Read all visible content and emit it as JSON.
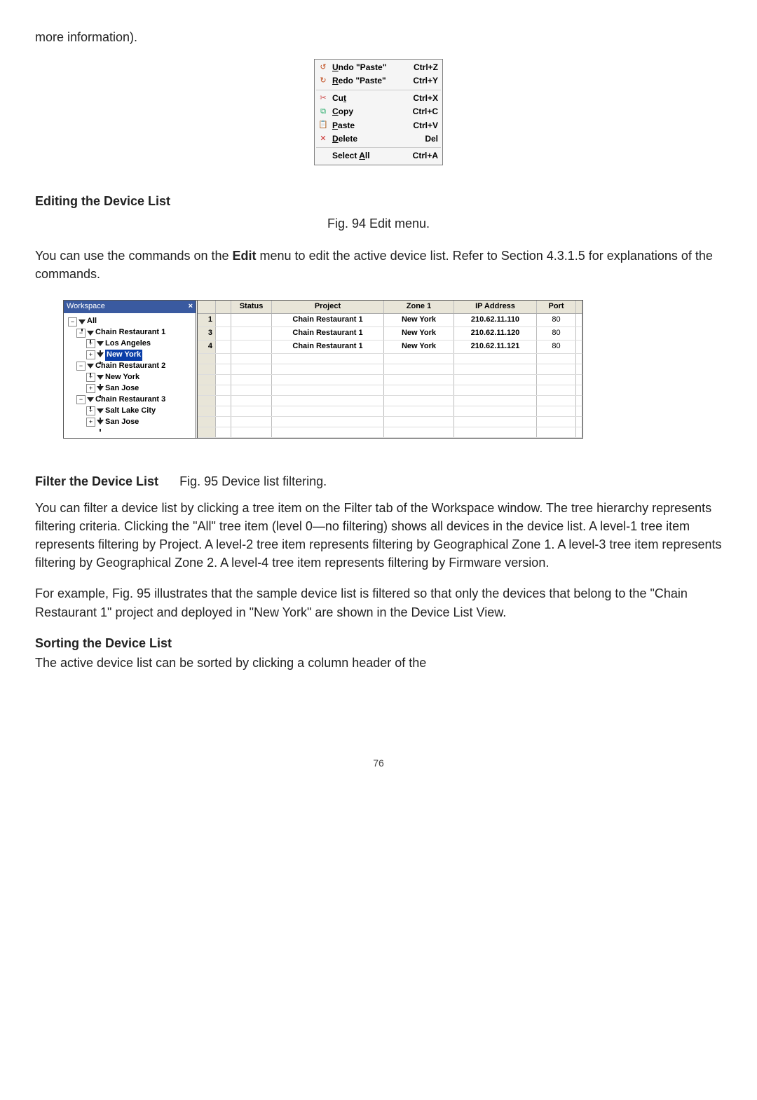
{
  "intro": "more information).",
  "edit_menu": {
    "items": [
      {
        "icon": "undo-icon",
        "glyph": "↺",
        "color": "#c04a1a",
        "label": "Undo \"Paste\"",
        "mn": "U",
        "rest": "ndo \"Paste\"",
        "shortcut": "Ctrl+Z"
      },
      {
        "icon": "redo-icon",
        "glyph": "↻",
        "color": "#c04a1a",
        "label": "Redo \"Paste\"",
        "mn": "R",
        "rest": "edo \"Paste\"",
        "shortcut": "Ctrl+Y"
      },
      {
        "sep": true
      },
      {
        "icon": "cut-icon",
        "glyph": "✂",
        "color": "#c44",
        "label": "Cut",
        "mn": "",
        "pre": "Cu",
        "mn2": "t",
        "shortcut": "Ctrl+X"
      },
      {
        "icon": "copy-icon",
        "glyph": "⧉",
        "color": "#2a6",
        "label": "Copy",
        "mn": "C",
        "rest": "opy",
        "shortcut": "Ctrl+C"
      },
      {
        "icon": "paste-icon",
        "glyph": "📋",
        "color": "#2a6",
        "label": "Paste",
        "mn": "P",
        "rest": "aste",
        "shortcut": "Ctrl+V"
      },
      {
        "icon": "delete-icon",
        "glyph": "✕",
        "color": "#c33",
        "label": "Delete",
        "mn": "D",
        "rest": "elete",
        "shortcut": "Del"
      },
      {
        "sep": true
      },
      {
        "icon": "blank-icon",
        "glyph": "",
        "color": "#000",
        "label": "Select All",
        "pre": "Select ",
        "mn2": "A",
        "rest2": "ll",
        "shortcut": "Ctrl+A"
      }
    ]
  },
  "h1": "Editing the Device List",
  "cap1": "Fig. 94 Edit menu.",
  "para1a": "You can use the commands on the ",
  "para1b": "Edit",
  "para1c": " menu to edit the active device list. Refer to Section 4.3.1.5 for explanations of the commands.",
  "workspace": {
    "title": "Workspace",
    "tree": [
      {
        "lvl": 1,
        "exp": "−",
        "label": "All"
      },
      {
        "lvl": 2,
        "exp": "−",
        "label": "Chain Restaurant 1"
      },
      {
        "lvl": 3,
        "exp": "+",
        "label": "Los Angeles"
      },
      {
        "lvl": 3,
        "exp": "+",
        "label": "New York",
        "selected": true
      },
      {
        "lvl": 2,
        "exp": "−",
        "label": "Chain Restaurant 2"
      },
      {
        "lvl": 3,
        "exp": "+",
        "label": "New York"
      },
      {
        "lvl": 3,
        "exp": "+",
        "label": "San Jose"
      },
      {
        "lvl": 2,
        "exp": "−",
        "label": "Chain Restaurant 3"
      },
      {
        "lvl": 3,
        "exp": "+",
        "label": "Salt Lake City"
      },
      {
        "lvl": 3,
        "exp": "+",
        "label": "San Jose"
      }
    ]
  },
  "grid": {
    "headers": {
      "status": "Status",
      "project": "Project",
      "zone": "Zone 1",
      "ip": "IP Address",
      "port": "Port"
    },
    "rows": [
      {
        "n": "1",
        "project": "Chain Restaurant 1",
        "zone": "New York",
        "ip": "210.62.11.110",
        "port": "80"
      },
      {
        "n": "3",
        "project": "Chain Restaurant 1",
        "zone": "New York",
        "ip": "210.62.11.120",
        "port": "80"
      },
      {
        "n": "4",
        "project": "Chain Restaurant 1",
        "zone": "New York",
        "ip": "210.62.11.121",
        "port": "80"
      }
    ]
  },
  "h2": "Filter the Device List",
  "cap2": "Fig. 95 Device list filtering.",
  "para2": "You can filter a device list by clicking a tree item on the Filter tab of the Workspace window. The tree hierarchy represents filtering criteria. Clicking the \"All\" tree item (level 0—no filtering) shows all devices in the device list. A level-1 tree item represents filtering by Project. A level-2 tree item represents filtering by Geographical Zone 1. A level-3 tree item represents filtering by Geographical Zone 2. A level-4 tree item represents filtering by Firmware version.",
  "para3": "For example, Fig. 95 illustrates that the sample device list is filtered so that only the devices that belong to the \"Chain Restaurant 1\" project and deployed in \"New York\" are shown in the Device List View.",
  "h3": "Sorting the Device List",
  "para4": "The active device list can be sorted by clicking a column header of the",
  "page": "76"
}
